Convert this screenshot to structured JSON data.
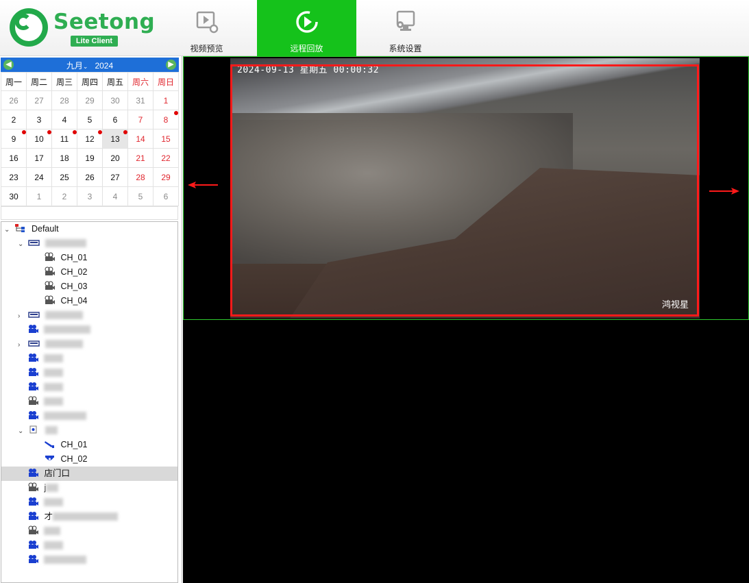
{
  "app": {
    "logo_text": "Seetong",
    "logo_badge": "Lite Client"
  },
  "toolbar": {
    "tabs": [
      {
        "label": "视频预览",
        "icon": "video-preview-icon",
        "active": false
      },
      {
        "label": "远程回放",
        "icon": "playback-icon",
        "active": true
      },
      {
        "label": "系统设置",
        "icon": "settings-icon",
        "active": false
      }
    ],
    "active_color": "#15c21b"
  },
  "calendar": {
    "month": "九月",
    "year": "2024",
    "weekdays": [
      "周一",
      "周二",
      "周三",
      "周四",
      "周五",
      "周六",
      "周日"
    ],
    "weeks": [
      [
        "26",
        "27",
        "28",
        "29",
        "30",
        "31",
        "1"
      ],
      [
        "2",
        "3",
        "4",
        "5",
        "6",
        "7",
        "8"
      ],
      [
        "9",
        "10",
        "11",
        "12",
        "13",
        "14",
        "15"
      ],
      [
        "16",
        "17",
        "18",
        "19",
        "20",
        "21",
        "22"
      ],
      [
        "23",
        "24",
        "25",
        "26",
        "27",
        "28",
        "29"
      ],
      [
        "30",
        "1",
        "2",
        "3",
        "4",
        "5",
        "6"
      ]
    ],
    "selected_day": "13",
    "days_with_recordings": [
      "8",
      "9",
      "10",
      "11",
      "12",
      "13"
    ],
    "header_color": "#1e6fd8",
    "weekend_color": "#e0262e"
  },
  "tree": {
    "root": "Default",
    "group1_channels": [
      "CH_01",
      "CH_02",
      "CH_03",
      "CH_04"
    ],
    "group5_channels": [
      "CH_01",
      "CH_02"
    ],
    "selected_camera": "店门口",
    "camera_prefix_j": "j",
    "camera_prefix_2": "才"
  },
  "video": {
    "timestamp": "2024-09-13 星期五 00:00:32",
    "watermark": "鸿视星",
    "frame_border_color": "#2ec92e",
    "annotation_color": "#ff1a1a"
  }
}
